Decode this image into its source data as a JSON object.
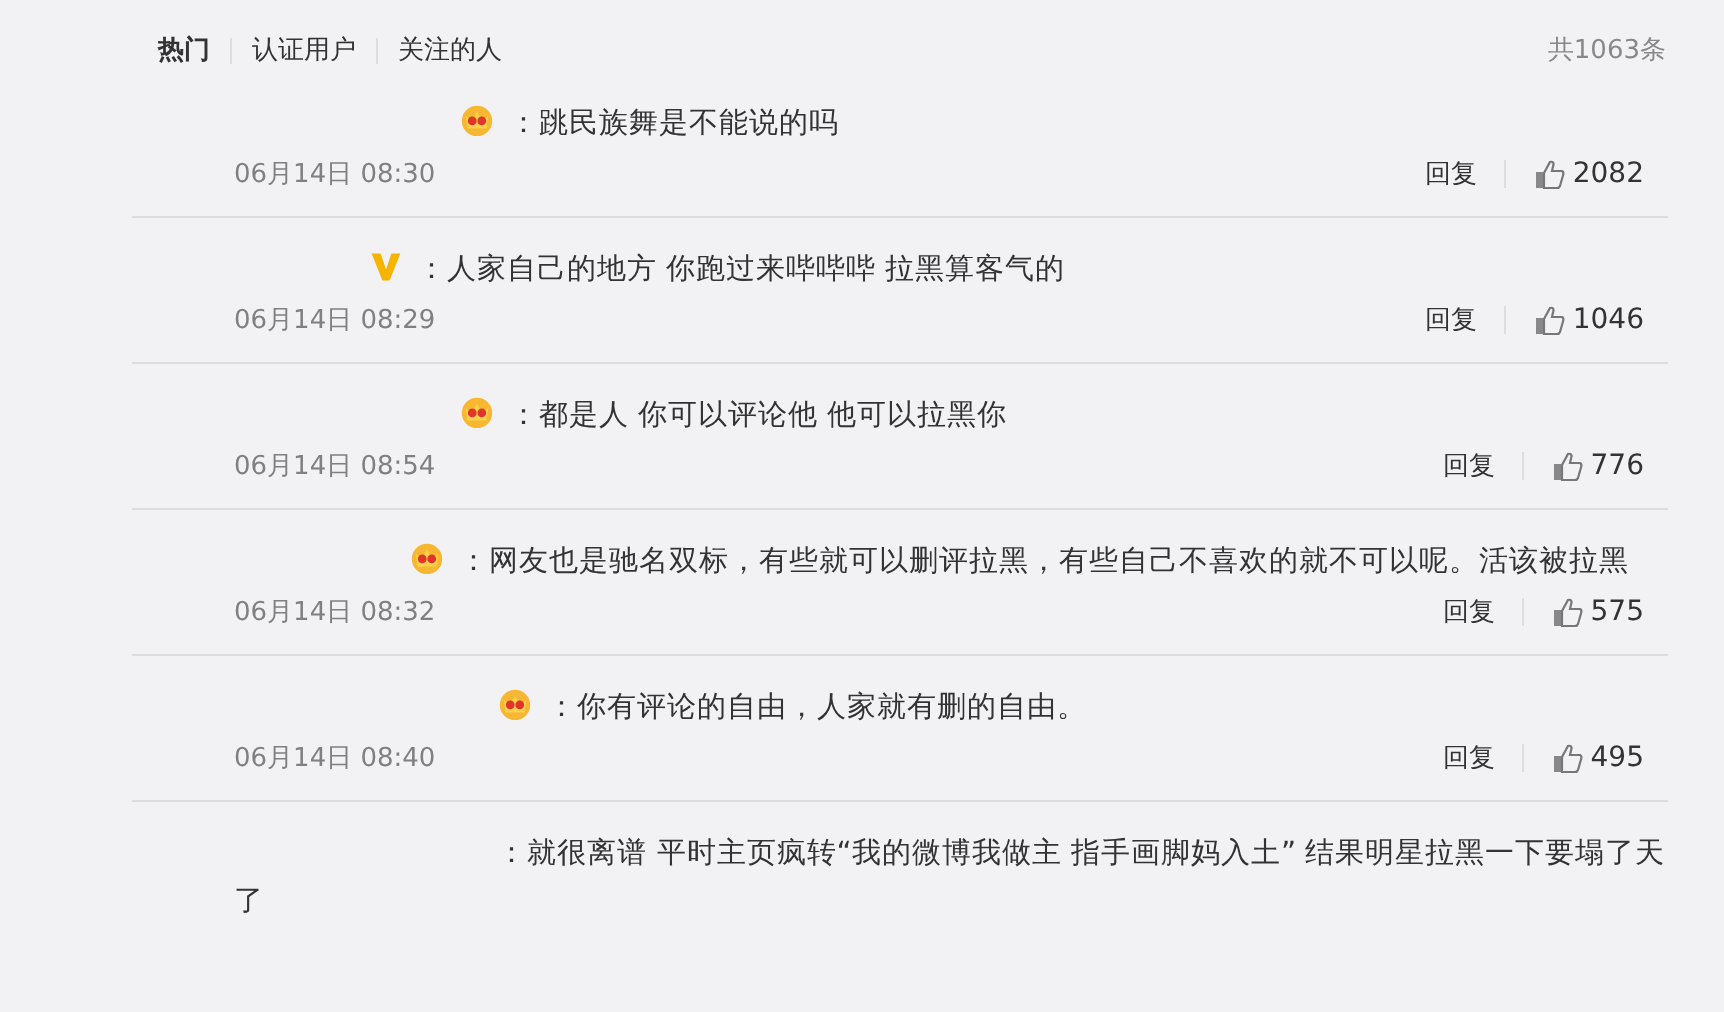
{
  "tabs": [
    {
      "label": "热门",
      "selected": true
    },
    {
      "label": "认证用户",
      "selected": false
    },
    {
      "label": "关注的人",
      "selected": false
    }
  ],
  "total": "共1063条",
  "comments": [
    {
      "kind": "crown",
      "text": "：跳民族舞是不能说的吗",
      "time": "06月14日 08:30",
      "reply": "回复",
      "likes": "2082"
    },
    {
      "kind": "v",
      "text": "：人家自己的地方 你跑过来哔哔哔 拉黑算客气的",
      "time": "06月14日 08:29",
      "reply": "回复",
      "likes": "1046"
    },
    {
      "kind": "crown",
      "text": "：都是人 你可以评论他 他可以拉黑你",
      "time": "06月14日 08:54",
      "reply": "回复",
      "likes": "776"
    },
    {
      "kind": "crown",
      "text": "：网友也是驰名双标，有些就可以删评拉黑，有些自己不喜欢的就不可以呢。活该被拉黑",
      "time": "06月14日 08:32",
      "reply": "回复",
      "likes": "575"
    },
    {
      "kind": "crown",
      "text": "：你有评论的自由，人家就有删的自由。",
      "time": "06月14日 08:40",
      "reply": "回复",
      "likes": "495"
    },
    {
      "text": "：就很离谱 平时主页疯转“我的微博我做主 指手画脚妈入土” 结果明星拉黑一下要塌了天了"
    }
  ]
}
